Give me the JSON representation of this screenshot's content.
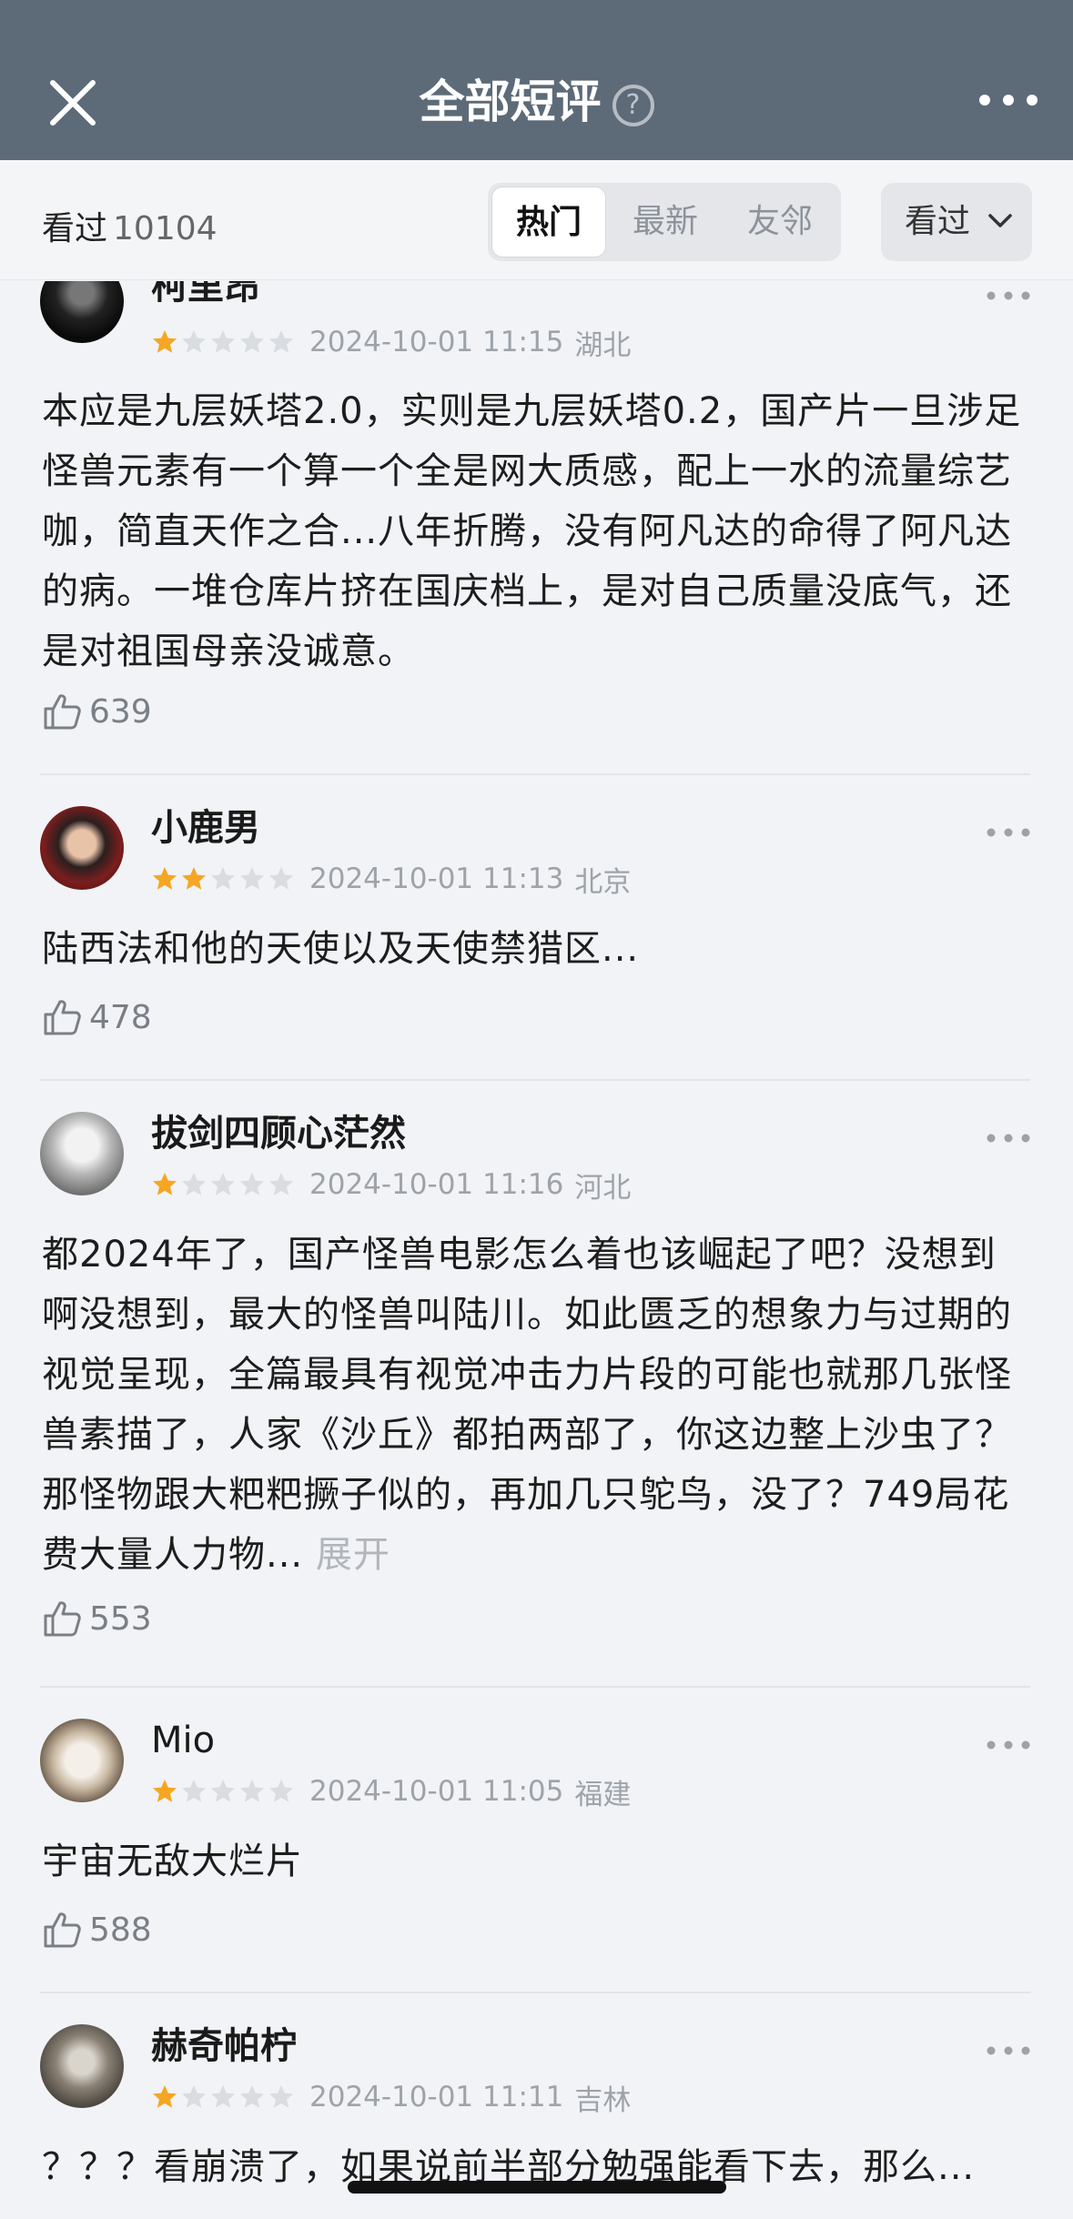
{
  "nav": {
    "title": "全部短评",
    "help_icon": "?"
  },
  "filter": {
    "seen_label": "看过",
    "seen_count": "10104",
    "tabs": [
      {
        "label": "热门",
        "active": true
      },
      {
        "label": "最新",
        "active": false
      },
      {
        "label": "友邻",
        "active": false
      }
    ],
    "dropdown_label": "看过"
  },
  "comments": [
    {
      "user": "柯里昂",
      "rating": 1,
      "time": "2024-10-01 11:15",
      "location": "湖北",
      "text": "本应是九层妖塔2.0，实则是九层妖塔0.2，国产片一旦涉足怪兽元素有一个算一个全是网大质感，配上一水的流量综艺咖，简直天作之合...八年折腾，没有阿凡达的命得了阿凡达的病。一堆仓库片挤在国庆档上，是对自己质量没底气，还是对祖国母亲没诚意。",
      "likes": "639"
    },
    {
      "user": "小鹿男",
      "rating": 2,
      "time": "2024-10-01 11:13",
      "location": "北京",
      "text": "陆西法和他的天使以及天使禁猎区...",
      "likes": "478"
    },
    {
      "user": "拔剑四顾心茫然",
      "rating": 1,
      "time": "2024-10-01 11:16",
      "location": "河北",
      "text": "都2024年了，国产怪兽电影怎么着也该崛起了吧？没想到啊没想到，最大的怪兽叫陆川。如此匮乏的想象力与过期的视觉呈现，全篇最具有视觉冲击力片段的可能也就那几张怪兽素描了，人家《沙丘》都拍两部了，你这边整上沙虫了？那怪物跟大粑粑撅子似的，再加几只鸵鸟，没了？749局花费大量人力物...",
      "expand": "展开",
      "likes": "553"
    },
    {
      "user": "Mio",
      "rating": 1,
      "time": "2024-10-01 11:05",
      "location": "福建",
      "text": "宇宙无敌大烂片",
      "likes": "588"
    },
    {
      "user": "赫奇帕柠",
      "rating": 1,
      "time": "2024-10-01 11:11",
      "location": "吉林",
      "text": "？？？看崩溃了，如果说前半部分勉强能看下去，那么...",
      "likes": ""
    }
  ],
  "colors": {
    "nav_bg": "#5d6a78",
    "star_on": "#f5a623",
    "star_off": "#d9dce0"
  }
}
